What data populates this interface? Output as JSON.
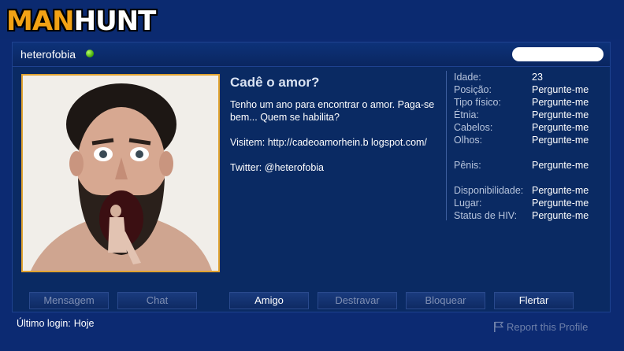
{
  "brand": {
    "logo_part1": "MAN",
    "logo_part2": "HUNT"
  },
  "profile": {
    "username": "heterofobia",
    "status": "online",
    "headline": "Cadê o amor?",
    "description": [
      "Tenho um ano para encontrar o amor. Paga-se bem... Quem se habilita?",
      "Visitem: http://cadeoamorhein.b logspot.com/",
      "Twitter: @heterofobia"
    ]
  },
  "stats": {
    "group1": [
      {
        "label": "Idade:",
        "value": "23"
      },
      {
        "label": "Posição:",
        "value": "Pergunte-me"
      },
      {
        "label": "Tipo físico:",
        "value": "Pergunte-me"
      },
      {
        "label": "Étnia:",
        "value": "Pergunte-me"
      },
      {
        "label": "Cabelos:",
        "value": "Pergunte-me"
      },
      {
        "label": "Olhos:",
        "value": "Pergunte-me"
      }
    ],
    "group2": [
      {
        "label": "Pênis:",
        "value": "Pergunte-me"
      }
    ],
    "group3": [
      {
        "label": "Disponibilidade:",
        "value": "Pergunte-me"
      },
      {
        "label": "Lugar:",
        "value": "Pergunte-me"
      },
      {
        "label": "Status de HIV:",
        "value": "Pergunte-me"
      }
    ]
  },
  "actions": {
    "mensagem": "Mensagem",
    "chat": "Chat",
    "amigo": "Amigo",
    "destravar": "Destravar",
    "bloquear": "Bloquear",
    "flertar": "Flertar"
  },
  "footer": {
    "last_login_label": "Último login:",
    "last_login_value": "Hoje",
    "report_label": "Report this Profile"
  },
  "colors": {
    "page_bg": "#0c2a72",
    "panel_bg": "#0a2a63",
    "photo_border": "#e0a331",
    "online": "#3ea300",
    "disabled_text": "#7f8fb3"
  },
  "icons": {
    "online": "online-status-icon",
    "report": "flag-icon"
  }
}
